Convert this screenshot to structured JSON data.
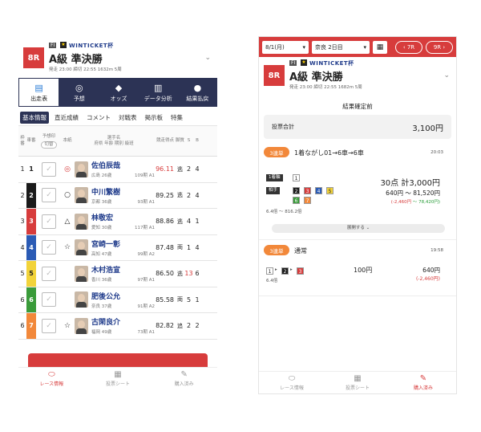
{
  "left": {
    "race_no": "8R",
    "grade": "FI",
    "cup": "WINTICKET杯",
    "title": "A級 準決勝",
    "info": "発走 23:00  締切 22:55  1632m 5周",
    "navtabs": [
      {
        "label": "出走表",
        "icon": "▤",
        "active": true
      },
      {
        "label": "予想",
        "icon": "◎",
        "active": false
      },
      {
        "label": "オッズ",
        "icon": "◆",
        "active": false
      },
      {
        "label": "データ分析",
        "icon": "▥",
        "active": false
      },
      {
        "label": "結果払戻",
        "icon": "●",
        "active": false
      }
    ],
    "subtabs": [
      "基本情報",
      "直近成績",
      "コメント",
      "対戦表",
      "掲示板",
      "特集"
    ],
    "headers": {
      "no": "枠番",
      "car": "車番",
      "pred": "予想印",
      "pred_sub": "切替",
      "mark": "本紙",
      "name": "選手名",
      "name_sub": "府県 年齢 期別 級班",
      "score": "競走得点",
      "leg": "脚質",
      "s": "S",
      "b": "B"
    },
    "rows": [
      {
        "no": "1",
        "car": "1",
        "car_bg": "#ffffff",
        "car_fg": "#222",
        "mark": "◎",
        "name": "佐伯辰哉",
        "pref": "広島 26歳",
        "term": "109期 A1",
        "score": "96.11",
        "score_red": true,
        "leg": "逃",
        "s": "2",
        "b": "4"
      },
      {
        "no": "2",
        "car": "2",
        "car_bg": "#1a1a1a",
        "car_fg": "#ffffff",
        "mark": "○",
        "name": "中川繁樹",
        "pref": "京都 36歳",
        "term": "93期 A1",
        "score": "89.25",
        "score_red": false,
        "leg": "逃",
        "s": "2",
        "b": "4"
      },
      {
        "no": "3",
        "car": "3",
        "car_bg": "#d73c3c",
        "car_fg": "#ffffff",
        "mark": "△",
        "name": "林敬宏",
        "pref": "愛知 30歳",
        "term": "117期 A1",
        "score": "88.86",
        "score_red": false,
        "leg": "逃",
        "s": "4",
        "b": "1"
      },
      {
        "no": "4",
        "car": "4",
        "car_bg": "#2b5bb5",
        "car_fg": "#ffffff",
        "mark": "☆",
        "name": "宮崎一彰",
        "pref": "高知 47歳",
        "term": "99期 A2",
        "score": "87.48",
        "score_red": false,
        "leg": "両",
        "s": "1",
        "b": "4"
      },
      {
        "no": "5",
        "car": "5",
        "car_bg": "#f2d33a",
        "car_fg": "#222",
        "mark": "",
        "name": "木村浩宣",
        "pref": "香川 36歳",
        "term": "97期 A1",
        "score": "86.50",
        "score_red": false,
        "leg": "逃",
        "s": "13",
        "b": "6"
      },
      {
        "no": "6",
        "car": "6",
        "car_bg": "#3a9b3a",
        "car_fg": "#ffffff",
        "mark": "",
        "name": "肥後公允",
        "pref": "奈良 37歳",
        "term": "91期 A2",
        "score": "85.58",
        "score_red": false,
        "leg": "両",
        "s": "5",
        "b": "1"
      },
      {
        "no": "6",
        "car": "7",
        "car_bg": "#f2883a",
        "car_fg": "#ffffff",
        "mark": "☆",
        "name": "古閑良介",
        "pref": "福岡 49歳",
        "term": "73期 A1",
        "score": "82.82",
        "score_red": false,
        "leg": "追",
        "s": "2",
        "b": "2"
      }
    ],
    "cta": "選んだ選手のオッズを見る（現在）",
    "bottom": [
      {
        "label": "レース情報",
        "icon": "⬭",
        "active": true
      },
      {
        "label": "投票シート",
        "icon": "▦",
        "active": false
      },
      {
        "label": "購入済み",
        "icon": "✎",
        "active": false
      }
    ]
  },
  "right": {
    "date": "8/1(月)",
    "venue": "奈良 2日目",
    "prev": "7R",
    "next": "9R",
    "race_no": "8R",
    "grade": "FI",
    "cup": "WINTICKET杯",
    "title": "A級 準決勝",
    "info": "発走 23:00  締切 22:55  1682m 5周",
    "confirm": "結果確定前",
    "total_label": "投票合計",
    "total_value": "3,100円",
    "bet1": {
      "type": "3連単",
      "title": "1着ながし01→6車→6車",
      "time": "20:03",
      "axis_label": "1着軸",
      "axis_num": "1",
      "partner_label": "相手",
      "partners": [
        "2",
        "3",
        "4",
        "5",
        "6",
        "7"
      ],
      "points": "30点",
      "amount": "計3,000円",
      "range": "640円 〜 81,520円",
      "diff_neg": "(-2,460円",
      "diff_pos": "〜 78,420円)",
      "odds": "6.4倍 〜 816.2倍",
      "expand": "展開する"
    },
    "bet2": {
      "type": "3連単",
      "title": "通常",
      "time": "19:58",
      "combo": [
        "1",
        "2",
        "3"
      ],
      "stake": "100円",
      "payout": "640円",
      "diff": "(-2,460円)",
      "odds": "6.4倍"
    },
    "bottom": [
      {
        "label": "レース情報",
        "icon": "⬭",
        "active": false
      },
      {
        "label": "投票シート",
        "icon": "▦",
        "active": false
      },
      {
        "label": "購入済み",
        "icon": "✎",
        "active": true
      }
    ]
  }
}
